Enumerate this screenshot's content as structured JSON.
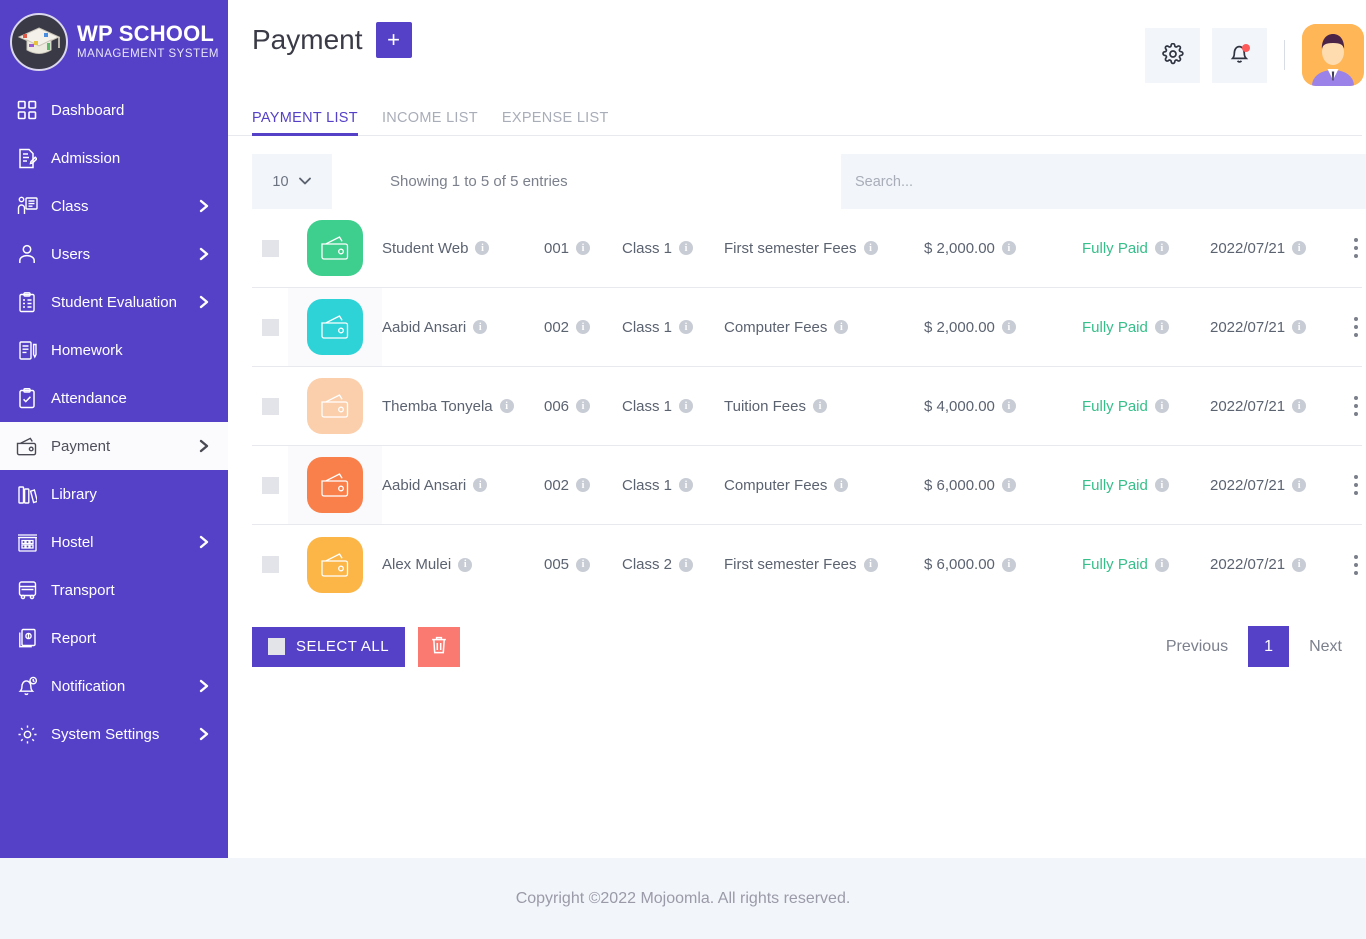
{
  "brand": {
    "title": "WP SCHOOL",
    "subtitle": "MANAGEMENT SYSTEM",
    "logo_icon": "graduation-cap-logo"
  },
  "sidebar": {
    "items": [
      {
        "label": "Dashboard",
        "icon": "grid-icon",
        "chevron": false,
        "active": false
      },
      {
        "label": "Admission",
        "icon": "document-pen-icon",
        "chevron": false,
        "active": false
      },
      {
        "label": "Class",
        "icon": "teacher-icon",
        "chevron": true,
        "active": false
      },
      {
        "label": "Users",
        "icon": "user-icon",
        "chevron": true,
        "active": false
      },
      {
        "label": "Student Evaluation",
        "icon": "clipboard-check-icon",
        "chevron": true,
        "active": false
      },
      {
        "label": "Homework",
        "icon": "book-pen-icon",
        "chevron": false,
        "active": false
      },
      {
        "label": "Attendance",
        "icon": "clipboard-tick-icon",
        "chevron": false,
        "active": false
      },
      {
        "label": "Payment",
        "icon": "wallet-icon",
        "chevron": true,
        "active": true
      },
      {
        "label": "Library",
        "icon": "books-icon",
        "chevron": false,
        "active": false
      },
      {
        "label": "Hostel",
        "icon": "hotel-icon",
        "chevron": true,
        "active": false
      },
      {
        "label": "Transport",
        "icon": "bus-icon",
        "chevron": false,
        "active": false
      },
      {
        "label": "Report",
        "icon": "report-icon",
        "chevron": false,
        "active": false
      },
      {
        "label": "Notification",
        "icon": "bell-icon",
        "chevron": true,
        "active": false
      },
      {
        "label": "System Settings",
        "icon": "gear-icon",
        "chevron": true,
        "active": false
      }
    ]
  },
  "header": {
    "title": "Payment",
    "add_label": "+",
    "settings_icon": "gear-icon",
    "notifications_icon": "bell-icon",
    "avatar_icon": "user-avatar"
  },
  "tabs": [
    {
      "label": "PAYMENT LIST",
      "active": true
    },
    {
      "label": "INCOME LIST",
      "active": false
    },
    {
      "label": "EXPENSE LIST",
      "active": false
    }
  ],
  "toolbar": {
    "page_length": "10",
    "page_length_caret": "chevron-down-icon",
    "showing_text": "Showing 1 to 5 of 5 entries",
    "search_placeholder": "Search...",
    "search_value": ""
  },
  "table": {
    "rows": [
      {
        "name": "Student Web",
        "id": "001",
        "class": "Class 1",
        "fee": "First semester Fees",
        "amount": "$ 2,000.00",
        "status": "Fully Paid",
        "date": "2022/07/21",
        "color": "#3ecf8e"
      },
      {
        "name": "Aabid Ansari",
        "id": "002",
        "class": "Class 1",
        "fee": "Computer Fees",
        "amount": "$ 2,000.00",
        "status": "Fully Paid",
        "date": "2022/07/21",
        "color": "#2ed3d8"
      },
      {
        "name": "Themba Tonyela",
        "id": "006",
        "class": "Class 1",
        "fee": "Tuition Fees",
        "amount": "$ 4,000.00",
        "status": "Fully Paid",
        "date": "2022/07/21",
        "color": "#fbcfab"
      },
      {
        "name": "Aabid Ansari",
        "id": "002",
        "class": "Class 1",
        "fee": "Computer Fees",
        "amount": "$ 6,000.00",
        "status": "Fully Paid",
        "date": "2022/07/21",
        "color": "#f9804b"
      },
      {
        "name": "Alex Mulei",
        "id": "005",
        "class": "Class 2",
        "fee": "First semester Fees",
        "amount": "$ 6,000.00",
        "status": "Fully Paid",
        "date": "2022/07/21",
        "color": "#fcb648"
      }
    ],
    "info_glyph": "i",
    "row_menu_icon": "kebab-menu-icon"
  },
  "footer_controls": {
    "select_all_label": "SELECT ALL",
    "delete_icon": "trash-icon",
    "previous_label": "Previous",
    "current_page": "1",
    "next_label": "Next"
  },
  "page_footer": {
    "copyright": "Copyright ©2022 Mojoomla. All rights reserved."
  },
  "colors": {
    "brand_purple": "#5541c8",
    "status_green": "#35bf8a",
    "delete_red": "#fa7a72",
    "panel_gray": "#f2f5fa"
  }
}
